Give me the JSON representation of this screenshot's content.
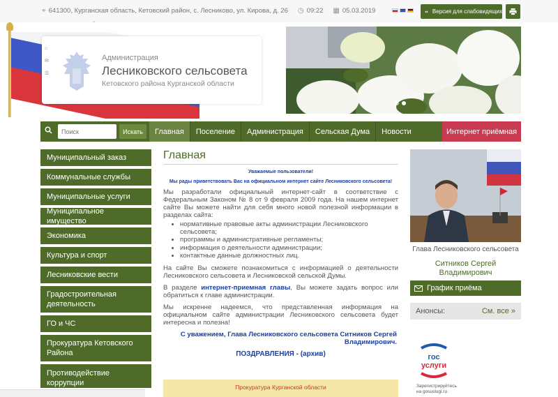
{
  "topbar": {
    "address": "641300, Курганская область, Кетовский район, с. Лесниково, ул. Кирова, д. 26",
    "time": "09:22",
    "date": "05.03.2019",
    "vision_label": "Версия для слабовидящих",
    "icons": [
      "map-marker-icon",
      "clock-icon",
      "calendar-icon",
      "eye-icon",
      "printer-icon"
    ]
  },
  "header": {
    "adm_small": "Администрация",
    "adm_big": "Лесниковского сельсовета",
    "adm_sub": "Кетовского района Курганской области"
  },
  "nav": {
    "search_placeholder": "Поиск",
    "search_button": "Искать",
    "items": [
      "Главная",
      "Поселение",
      "Администрация",
      "Сельская Дума",
      "Новости"
    ],
    "reception": "Интернет приёмная"
  },
  "sidebar": {
    "items": [
      "Муниципальный заказ",
      "Коммунальные службы",
      "Муниципальные услуги",
      "Муниципальное имущество",
      "Экономика",
      "Культура и спорт",
      "Лесниковские вести",
      "Градостроительная деятельность",
      "ГО и ЧС",
      "Прокуратура Кетовского Района",
      "Противодействие коррупции"
    ]
  },
  "main": {
    "title": "Главная",
    "greet1": "Уважаемые пользователи!",
    "greet2": "Мы рады приветствовать Вас на официальном интернет сайте  Лесниковского сельсовета!",
    "para1": "Мы разработали официальный интернет-сайт в соответствие с Федеральным Законом № 8 от 9 февраля 2009 года. На нашем интернет сайте Вы можете найти для себя много новой полезной информации в разделах сайта:",
    "list": [
      "нормативные правовые акты администрации Лесниковского сельсовета;",
      "программы и административные регламенты;",
      "информация о деятельности администрации;",
      "контактные данные должностных лиц."
    ],
    "para2": "На сайте Вы сможете познакомиться с информацией о деятельности Лесниковского сельсовета и Лесниковской сельской Думы.",
    "para3_a": "В разделе ",
    "para3_link": "интернет-приемная главы",
    "para3_b": ", Вы можете задать вопрос или обратиться к главе администрации.",
    "para4": "Мы искренне надеемся, что представленная информация на официальном сайте администрации Лесниковского сельсовета будет интересна и полезна!",
    "sign": "С уважением, Глава Лесниковского сельсовета Ситников Сергей Владимирович.",
    "congrats": "ПОЗДРАВЛЕНИЯ - (архив)",
    "notice": "Прокуратура Курганской области"
  },
  "right": {
    "head_caption": "Глава Лесниковского сельсовета",
    "head_name": "Ситников Сергей Владимирович",
    "schedule": "График приёма",
    "anons": "Анонсы:",
    "anons_link": "См. все »",
    "gos_line1": "Зарегистрируйтесь",
    "gos_line2": "на gosuslugi.ru"
  },
  "colors": {
    "brand_green": "#4e6b2a",
    "reception_red": "#c83a4f",
    "link_blue": "#1a3fa6"
  }
}
